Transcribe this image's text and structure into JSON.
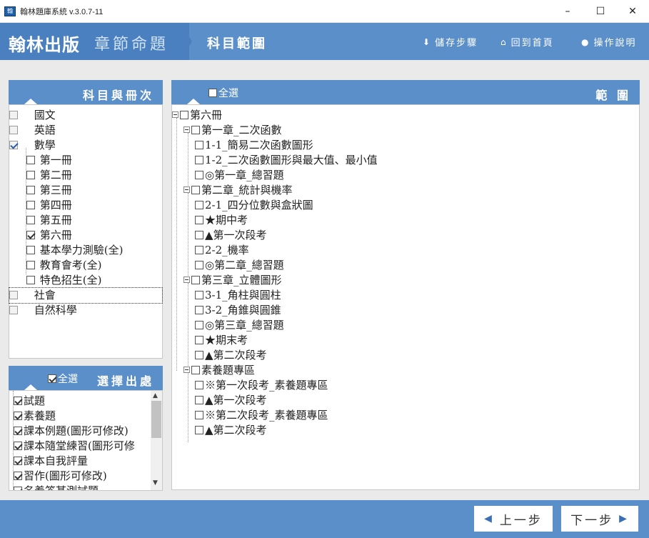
{
  "window": {
    "title": "翰林題庫系統 v.3.0.7-11",
    "min": "–",
    "max": "☐",
    "close": "✕"
  },
  "header": {
    "brand_strong": "翰林出版",
    "brand_light": "章節命題",
    "page_title": "科目範圍",
    "save": "儲存步驟",
    "home": "回到首頁",
    "help": "操作說明"
  },
  "subjects": {
    "title": "科目與冊次",
    "items": [
      {
        "label": "國文",
        "checked": false
      },
      {
        "label": "英語",
        "checked": false
      },
      {
        "label": "數學",
        "checked": true
      },
      {
        "label": "第一冊",
        "checked": false
      },
      {
        "label": "第二冊",
        "checked": false
      },
      {
        "label": "第三冊",
        "checked": false
      },
      {
        "label": "第四冊",
        "checked": false
      },
      {
        "label": "第五冊",
        "checked": false
      },
      {
        "label": "第六冊",
        "checked": true
      },
      {
        "label": "基本學力測驗(全)",
        "checked": false
      },
      {
        "label": "教育會考(全)",
        "checked": false
      },
      {
        "label": "特色招生(全)",
        "checked": false
      },
      {
        "label": "社會",
        "checked": false
      },
      {
        "label": "自然科學",
        "checked": false
      }
    ]
  },
  "sources": {
    "select_all": "全選",
    "title": "選擇出處",
    "items": [
      {
        "label": "試題",
        "checked": true
      },
      {
        "label": "素養題",
        "checked": true
      },
      {
        "label": "課本例題(圖形可修改)",
        "checked": true
      },
      {
        "label": "課本隨堂練習(圖形可修",
        "checked": true
      },
      {
        "label": "課本自我評量",
        "checked": true
      },
      {
        "label": "習作(圖形可修改)",
        "checked": true
      },
      {
        "label": "名着答某測試題",
        "checked": true
      }
    ]
  },
  "range": {
    "select_all": "全選",
    "title": "範 圍",
    "tree": [
      "第六冊",
      "第一章_二次函數",
      "1-1_簡易二次函數圖形",
      "1-2_二次函數圖形與最大值、最小值",
      "◎第一章_總習題",
      "第二章_統計與機率",
      "2-1_四分位數與盒狀圖",
      "★期中考",
      "▲第一次段考",
      "2-2_機率",
      "◎第二章_總習題",
      "第三章_立體圖形",
      "3-1_角柱與圓柱",
      "3-2_角錐與圓錐",
      "◎第三章_總習題",
      "★期末考",
      "▲第二次段考",
      "素養題專區",
      "※第一次段考_素養題專區",
      "▲第一次段考",
      "※第二次段考_素養題專區",
      "▲第二次段考"
    ]
  },
  "footer": {
    "prev": "上一步",
    "next": "下一步"
  },
  "colors": {
    "header": "#5b8fc9",
    "brand_panel": "#4a80c0",
    "workspace": "#eaeaea"
  }
}
